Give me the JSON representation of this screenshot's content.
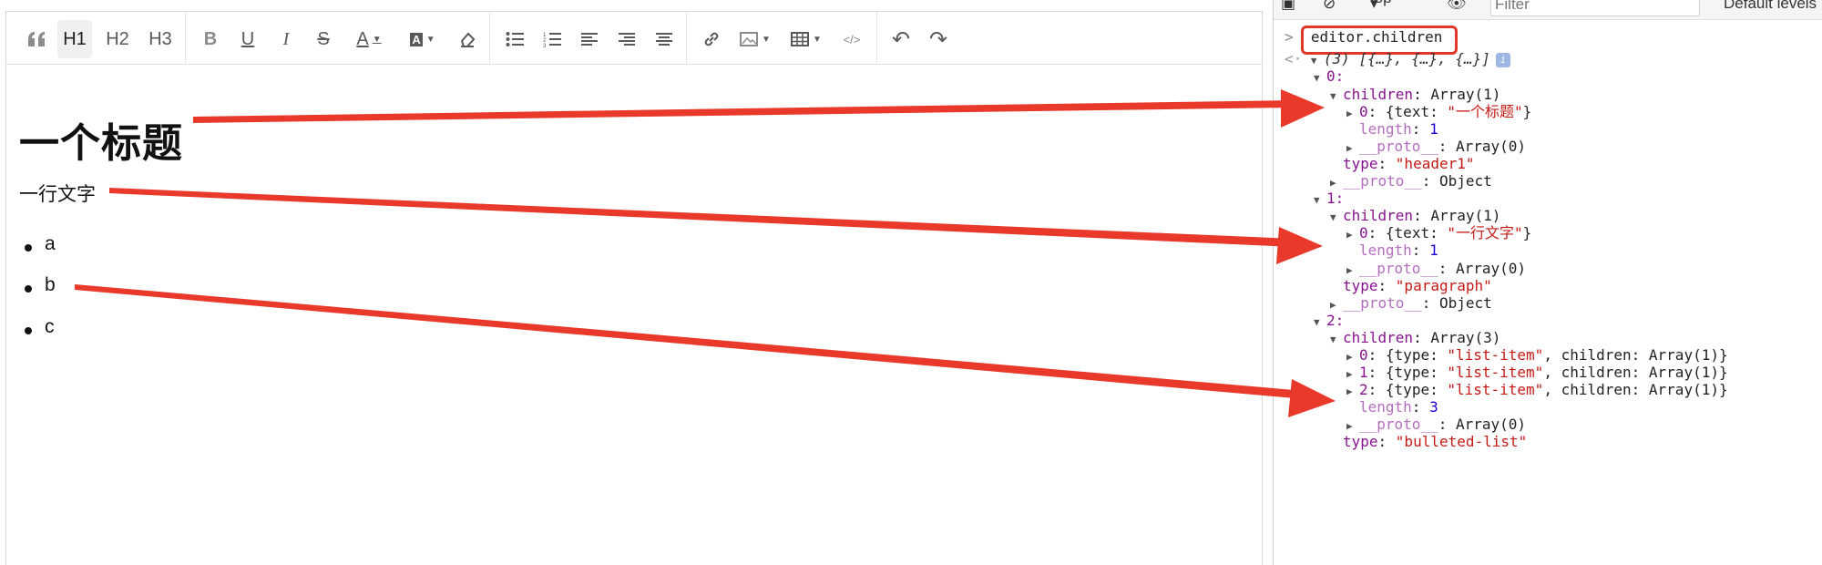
{
  "toolbar": {
    "items": [
      {
        "name": "blockquote-icon",
        "glyph": "❝"
      },
      {
        "name": "h1-button",
        "label": "H1"
      },
      {
        "name": "h2-button",
        "label": "H2"
      },
      {
        "name": "h3-button",
        "label": "H3"
      },
      {
        "name": "bold-icon",
        "glyph": "B"
      },
      {
        "name": "underline-icon",
        "glyph": "U"
      },
      {
        "name": "italic-icon",
        "glyph": "I"
      },
      {
        "name": "strikethrough-icon",
        "glyph": "S"
      },
      {
        "name": "font-color-icon",
        "glyph": "A"
      },
      {
        "name": "background-color-icon",
        "glyph": "A"
      },
      {
        "name": "eraser-icon",
        "glyph": "⌫"
      },
      {
        "name": "bulleted-list-icon",
        "glyph": "☰"
      },
      {
        "name": "numbered-list-icon",
        "glyph": "☷"
      },
      {
        "name": "align-left-icon",
        "glyph": "≡"
      },
      {
        "name": "align-right-icon",
        "glyph": "≡"
      },
      {
        "name": "align-center-icon",
        "glyph": "≡"
      },
      {
        "name": "link-icon",
        "glyph": "🔗"
      },
      {
        "name": "image-icon",
        "glyph": "▣"
      },
      {
        "name": "table-icon",
        "glyph": "▦"
      },
      {
        "name": "code-icon",
        "glyph": "</>"
      },
      {
        "name": "undo-icon",
        "glyph": "↶"
      },
      {
        "name": "redo-icon",
        "glyph": "↷"
      }
    ]
  },
  "editor": {
    "heading": "一个标题",
    "paragraph": "一行文字",
    "list": [
      "a",
      "b",
      "c"
    ]
  },
  "devtools": {
    "context": "top",
    "filter_placeholder": "Filter",
    "levels": "Default levels",
    "command": "editor.children",
    "result_summary": "(3) [{…}, {…}, {…}]",
    "info_badge": "i",
    "lines": {
      "i0": "0:",
      "children_label": "children",
      "array1": "Array(1)",
      "array3": "Array(3)",
      "array0": "Array(0)",
      "text_key": "text",
      "text0": "\"一个标题\"",
      "length_key": "length",
      "len1": "1",
      "len3": "3",
      "proto_key": "__proto__",
      "object": "Object",
      "type_key": "type",
      "type0": "\"header1\"",
      "i1": "1:",
      "text1": "\"一行文字\"",
      "type1": "\"paragraph\"",
      "i2": "2:",
      "list_item": "\"list-item\"",
      "type2": "\"bulleted-list\""
    }
  },
  "colors": {
    "annotation_red": "#e8392a",
    "devtools_key": "#881391",
    "devtools_string": "#c41a16",
    "devtools_number": "#1c00cf"
  }
}
